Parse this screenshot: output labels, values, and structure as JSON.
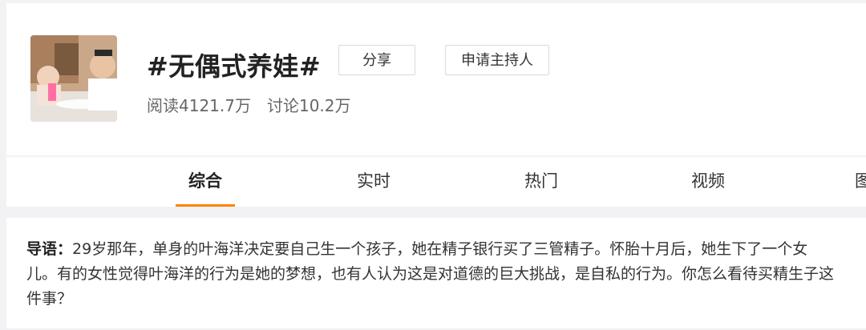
{
  "topic": {
    "title": "#无偶式养娃#",
    "share_label": "分享",
    "host_label": "申请主持人",
    "reads": "阅读4121.7万",
    "discussions": "讨论10.2万"
  },
  "tabs": [
    {
      "label": "综合",
      "active": true
    },
    {
      "label": "实时",
      "active": false
    },
    {
      "label": "热门",
      "active": false
    },
    {
      "label": "视频",
      "active": false
    },
    {
      "label": "图",
      "active": false
    }
  ],
  "guide": {
    "label": "导语：",
    "text": "29岁那年，单身的叶海洋决定要自己生一个孩子，她在精子银行买了三管精子。怀胎十月后，她生下了一个女儿。有的女性觉得叶海洋的行为是她的梦想，也有人认为这是对道德的巨大挑战，是自私的行为。你怎么看待买精生子这件事？"
  },
  "colors": {
    "accent": "#ff8200",
    "background": "#f2f2f5"
  }
}
